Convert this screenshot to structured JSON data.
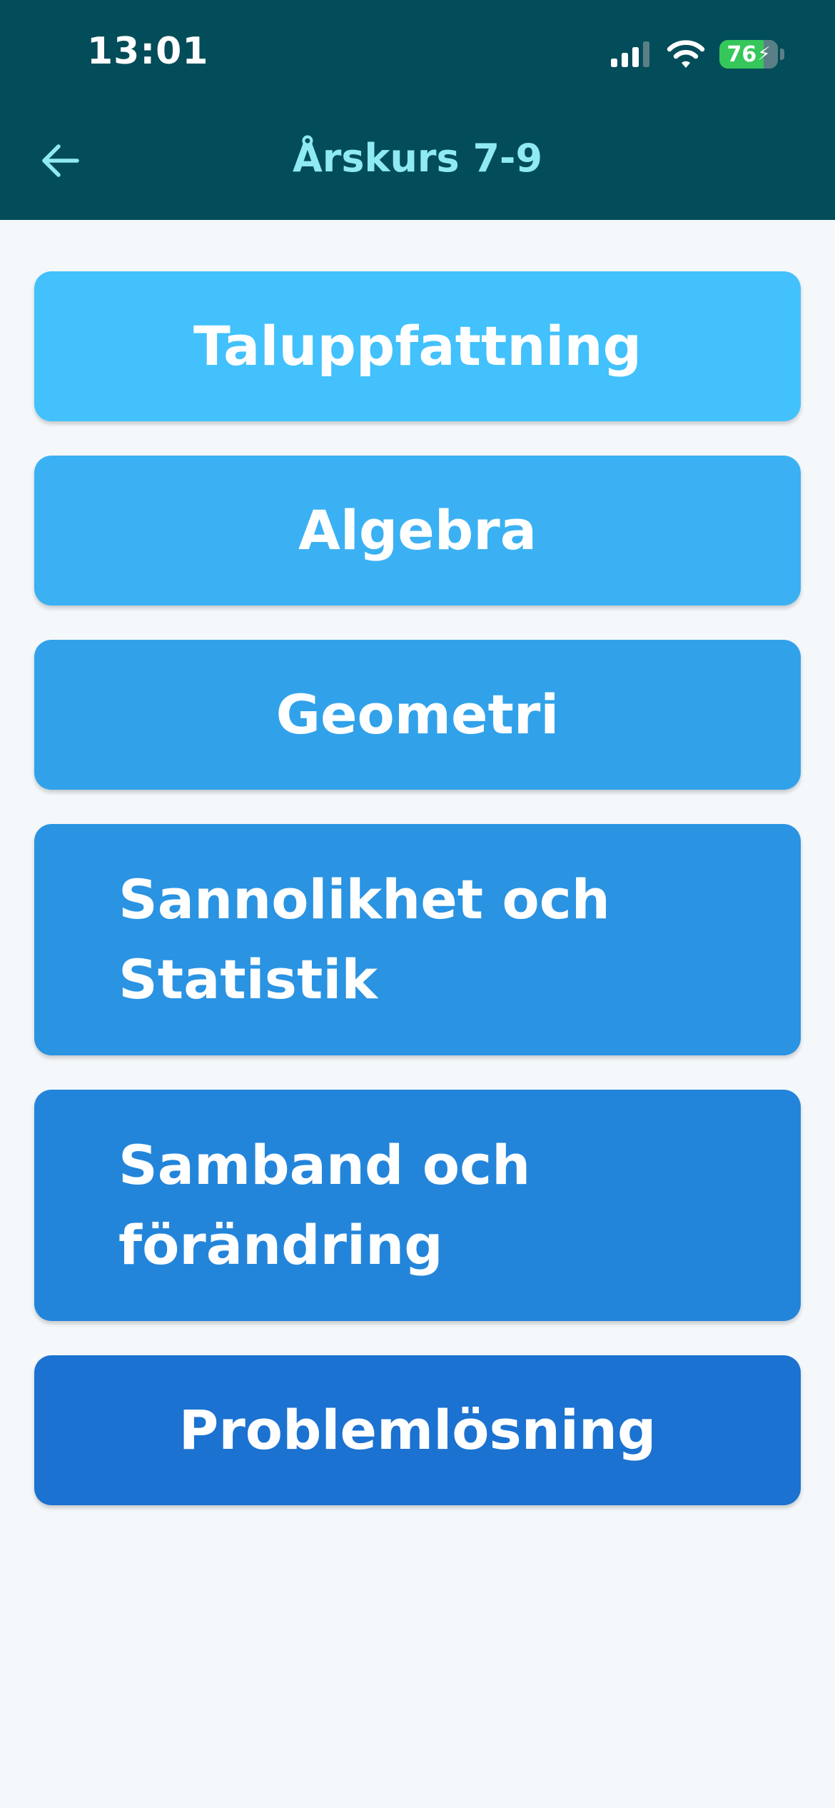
{
  "status_bar": {
    "time": "13:01",
    "battery_level": "76",
    "battery_charging": true,
    "icons": [
      "signal-icon",
      "wifi-icon",
      "battery-icon"
    ]
  },
  "nav": {
    "back_icon": "arrow-left-icon",
    "title": "Årskurs 7-9"
  },
  "colors": {
    "header_bg": "#024d59",
    "title": "#8feaf3",
    "page_bg": "#f4f8fb",
    "battery": "#35c759"
  },
  "topics": [
    {
      "label": "Taluppfattning",
      "color": "#42c1fc"
    },
    {
      "label": "Algebra",
      "color": "#3bb1f3"
    },
    {
      "label": "Geometri",
      "color": "#31a2ea"
    },
    {
      "label": "Sannolikhet och Statistik",
      "color": "#2a93e2"
    },
    {
      "label": "Samband och förändring",
      "color": "#2385da"
    },
    {
      "label": "Problemlösning",
      "color": "#1b72d0"
    }
  ]
}
